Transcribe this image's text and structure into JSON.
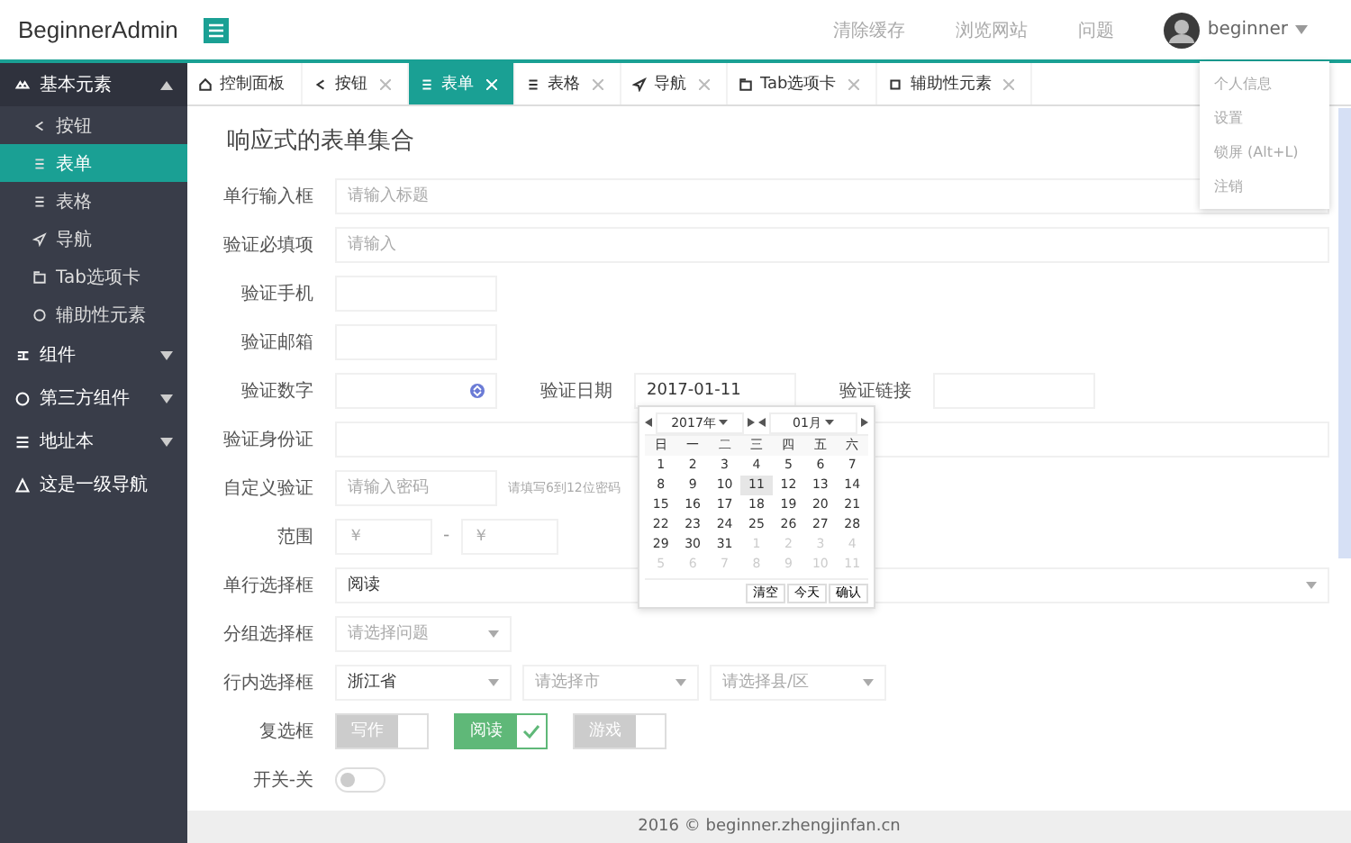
{
  "header": {
    "logo": "BeginnerAdmin",
    "links": [
      "清除缓存",
      "浏览网站",
      "问题"
    ],
    "user": "beginner",
    "user_menu": [
      "个人信息",
      "设置",
      "锁屏 (Alt+L)",
      "注销"
    ]
  },
  "sidebar": {
    "items": [
      {
        "label": "基本元素",
        "expanded": true,
        "selected": false,
        "children": [
          {
            "label": "按钮",
            "selected": false
          },
          {
            "label": "表单",
            "selected": true
          },
          {
            "label": "表格",
            "selected": false
          },
          {
            "label": "导航",
            "selected": false
          },
          {
            "label": "Tab选项卡",
            "selected": false
          },
          {
            "label": "辅助性元素",
            "selected": false
          }
        ]
      },
      {
        "label": "组件",
        "expanded": false,
        "selected": false
      },
      {
        "label": "第三方组件",
        "expanded": false,
        "selected": false
      },
      {
        "label": "地址本",
        "expanded": false,
        "selected": false
      },
      {
        "label": "这是一级导航",
        "selected": false
      }
    ]
  },
  "tabs": [
    {
      "label": "控制面板",
      "selected": false,
      "closable": false
    },
    {
      "label": "按钮",
      "selected": false,
      "closable": true
    },
    {
      "label": "表单",
      "selected": true,
      "closable": true
    },
    {
      "label": "表格",
      "selected": false,
      "closable": true
    },
    {
      "label": "导航",
      "selected": false,
      "closable": true
    },
    {
      "label": "Tab选项卡",
      "selected": false,
      "closable": true
    },
    {
      "label": "辅助性元素",
      "selected": false,
      "closable": true
    }
  ],
  "form": {
    "title": "响应式的表单集合",
    "rows": [
      {
        "kind": "input",
        "label": "单行输入框",
        "placeholder": "请输入标题",
        "block": true
      },
      {
        "kind": "input",
        "label": "验证必填项",
        "placeholder": "请输入",
        "block": true
      },
      {
        "kind": "input",
        "label": "验证手机",
        "block": false
      },
      {
        "kind": "input",
        "label": "验证邮箱",
        "block": false
      },
      {
        "kind": "triple",
        "items": [
          {
            "label": "验证数字",
            "kind": "number"
          },
          {
            "label": "验证日期",
            "kind": "date",
            "value": "2017-01-11"
          },
          {
            "label": "验证链接",
            "kind": "text"
          }
        ]
      },
      {
        "kind": "input",
        "label": "验证身份证",
        "block": true
      },
      {
        "kind": "input",
        "label": "自定义验证",
        "placeholder": "请输入密码",
        "help": "请填写6到12位密码",
        "block": false
      },
      {
        "kind": "range",
        "label": "范围",
        "from": "￥",
        "separator": "-",
        "to": "￥"
      },
      {
        "kind": "select",
        "label": "单行选择框",
        "value": "阅读",
        "block": true
      },
      {
        "kind": "select",
        "label": "分组选择框",
        "placeholder": "请选择问题",
        "block": false
      },
      {
        "kind": "selects",
        "label": "行内选择框",
        "selects": [
          {
            "value": "浙江省"
          },
          {
            "placeholder": "请选择市"
          },
          {
            "placeholder": "请选择县/区"
          }
        ]
      },
      {
        "kind": "checkboxes",
        "label": "复选框",
        "options": [
          {
            "label": "写作",
            "checked": false
          },
          {
            "label": "阅读",
            "checked": true
          },
          {
            "label": "游戏",
            "checked": false
          }
        ]
      },
      {
        "kind": "switch",
        "label": "开关-关",
        "on": false
      }
    ]
  },
  "calendar": {
    "year": "2017年",
    "month": "01月",
    "weekdays": [
      "日",
      "一",
      "二",
      "三",
      "四",
      "五",
      "六"
    ],
    "weeks": [
      [
        {
          "d": "1",
          "muted": false,
          "selected": false
        },
        {
          "d": "2",
          "muted": false,
          "selected": false
        },
        {
          "d": "3",
          "muted": false,
          "selected": false
        },
        {
          "d": "4",
          "muted": false,
          "selected": false
        },
        {
          "d": "5",
          "muted": false,
          "selected": false
        },
        {
          "d": "6",
          "muted": false,
          "selected": false
        },
        {
          "d": "7",
          "muted": false,
          "selected": false
        }
      ],
      [
        {
          "d": "8",
          "muted": false,
          "selected": false
        },
        {
          "d": "9",
          "muted": false,
          "selected": false
        },
        {
          "d": "10",
          "muted": false,
          "selected": false
        },
        {
          "d": "11",
          "muted": false,
          "selected": true
        },
        {
          "d": "12",
          "muted": false,
          "selected": false
        },
        {
          "d": "13",
          "muted": false,
          "selected": false
        },
        {
          "d": "14",
          "muted": false,
          "selected": false
        }
      ],
      [
        {
          "d": "15",
          "muted": false,
          "selected": false
        },
        {
          "d": "16",
          "muted": false,
          "selected": false
        },
        {
          "d": "17",
          "muted": false,
          "selected": false
        },
        {
          "d": "18",
          "muted": false,
          "selected": false
        },
        {
          "d": "19",
          "muted": false,
          "selected": false
        },
        {
          "d": "20",
          "muted": false,
          "selected": false
        },
        {
          "d": "21",
          "muted": false,
          "selected": false
        }
      ],
      [
        {
          "d": "22",
          "muted": false,
          "selected": false
        },
        {
          "d": "23",
          "muted": false,
          "selected": false
        },
        {
          "d": "24",
          "muted": false,
          "selected": false
        },
        {
          "d": "25",
          "muted": false,
          "selected": false
        },
        {
          "d": "26",
          "muted": false,
          "selected": false
        },
        {
          "d": "27",
          "muted": false,
          "selected": false
        },
        {
          "d": "28",
          "muted": false,
          "selected": false
        }
      ],
      [
        {
          "d": "29",
          "muted": false,
          "selected": false
        },
        {
          "d": "30",
          "muted": false,
          "selected": false
        },
        {
          "d": "31",
          "muted": false,
          "selected": false
        },
        {
          "d": "1",
          "muted": true,
          "selected": false
        },
        {
          "d": "2",
          "muted": true,
          "selected": false
        },
        {
          "d": "3",
          "muted": true,
          "selected": false
        },
        {
          "d": "4",
          "muted": true,
          "selected": false
        }
      ],
      [
        {
          "d": "5",
          "muted": true,
          "selected": false
        },
        {
          "d": "6",
          "muted": true,
          "selected": false
        },
        {
          "d": "7",
          "muted": true,
          "selected": false
        },
        {
          "d": "8",
          "muted": true,
          "selected": false
        },
        {
          "d": "9",
          "muted": true,
          "selected": false
        },
        {
          "d": "10",
          "muted": true,
          "selected": false
        },
        {
          "d": "11",
          "muted": true,
          "selected": false
        }
      ]
    ],
    "buttons": [
      "清空",
      "今天",
      "确认"
    ]
  },
  "footer": "2016 © beginner.zhengjinfan.cn"
}
